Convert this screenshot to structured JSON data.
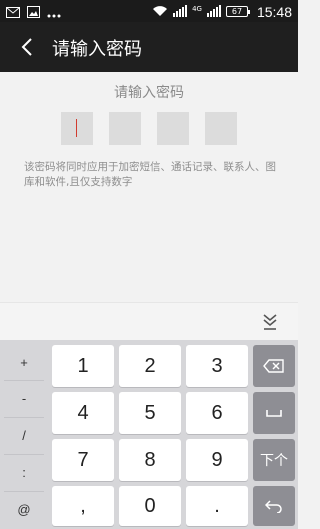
{
  "status_bar": {
    "time": "15:48",
    "battery": "67",
    "network": "4G"
  },
  "app_bar": {
    "title": "请输入密码"
  },
  "content": {
    "prompt": "请输入密码",
    "pin_length": 4,
    "note": "该密码将同时应用于加密短信、通话记录、联系人、图库和软件,且仅支持数字"
  },
  "keyboard": {
    "symbols": [
      "+",
      "-",
      "/",
      ":",
      "@"
    ],
    "rows": [
      [
        "1",
        "2",
        "3"
      ],
      [
        "4",
        "5",
        "6"
      ],
      [
        "7",
        "8",
        "9"
      ],
      [
        ",",
        "0",
        "."
      ]
    ],
    "next_label": "下个"
  }
}
